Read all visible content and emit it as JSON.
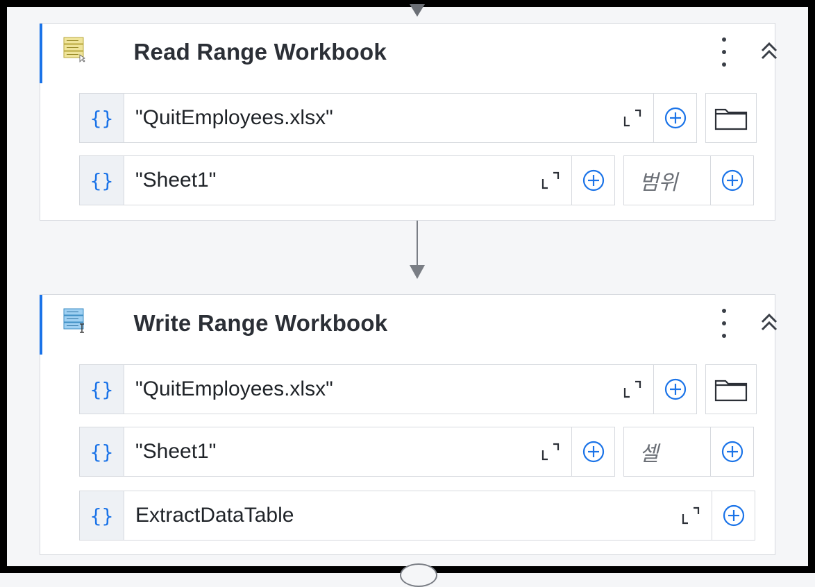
{
  "activities": [
    {
      "title": "Read Range Workbook",
      "icon": "read-range-icon",
      "fields": [
        {
          "value": "\"QuitEmployees.xlsx\""
        },
        {
          "value": "\"Sheet1\"",
          "extra_placeholder": "범위"
        }
      ]
    },
    {
      "title": "Write Range Workbook",
      "icon": "write-range-icon",
      "fields": [
        {
          "value": "\"QuitEmployees.xlsx\""
        },
        {
          "value": "\"Sheet1\"",
          "extra_placeholder": "셀"
        },
        {
          "value": "ExtractDataTable"
        }
      ]
    }
  ],
  "icons": {
    "variables": "{}",
    "more": "more-vertical-icon",
    "collapse": "double-chevron-up-icon",
    "expand": "expand-editor-icon",
    "add": "plus-circle-icon",
    "folder": "folder-icon"
  },
  "colors": {
    "accent": "#1a73e8",
    "card_border": "#d6d9de",
    "field_prefix_bg": "#eef1f5",
    "connector": "#7a7e85"
  }
}
